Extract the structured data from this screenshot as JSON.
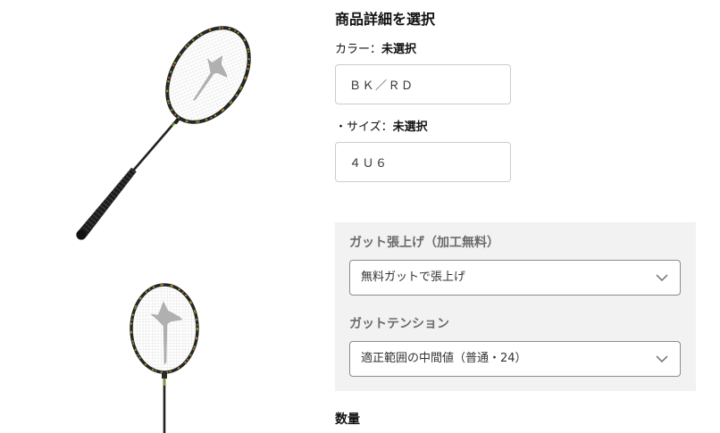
{
  "product_options": {
    "title": "商品詳細を選択",
    "color": {
      "label": "カラー：",
      "status": "未選択",
      "options": [
        "ＢＫ／ＲＤ"
      ]
    },
    "size": {
      "label": "・サイズ：",
      "status": "未選択",
      "options": [
        "４Ｕ６"
      ]
    },
    "stringing": {
      "label": "ガット張上げ（加工無料）",
      "selected": "無料ガットで張上げ",
      "icon": "chevron-down-icon"
    },
    "tension": {
      "label": "ガットテンション",
      "selected": "適正範囲の中間値（普通・24）",
      "icon": "chevron-down-icon"
    },
    "quantity": {
      "label": "数量"
    }
  },
  "theme": {
    "text": "#111111",
    "muted_label": "#6b6b6b",
    "panel_background": "#f2f2f2",
    "option_border": "#cccccc",
    "select_border": "#8c8c8c",
    "racket_frame": "#262626",
    "racket_accent_green": "#8aab2c",
    "racket_accent_orange": "#d07a2a"
  }
}
